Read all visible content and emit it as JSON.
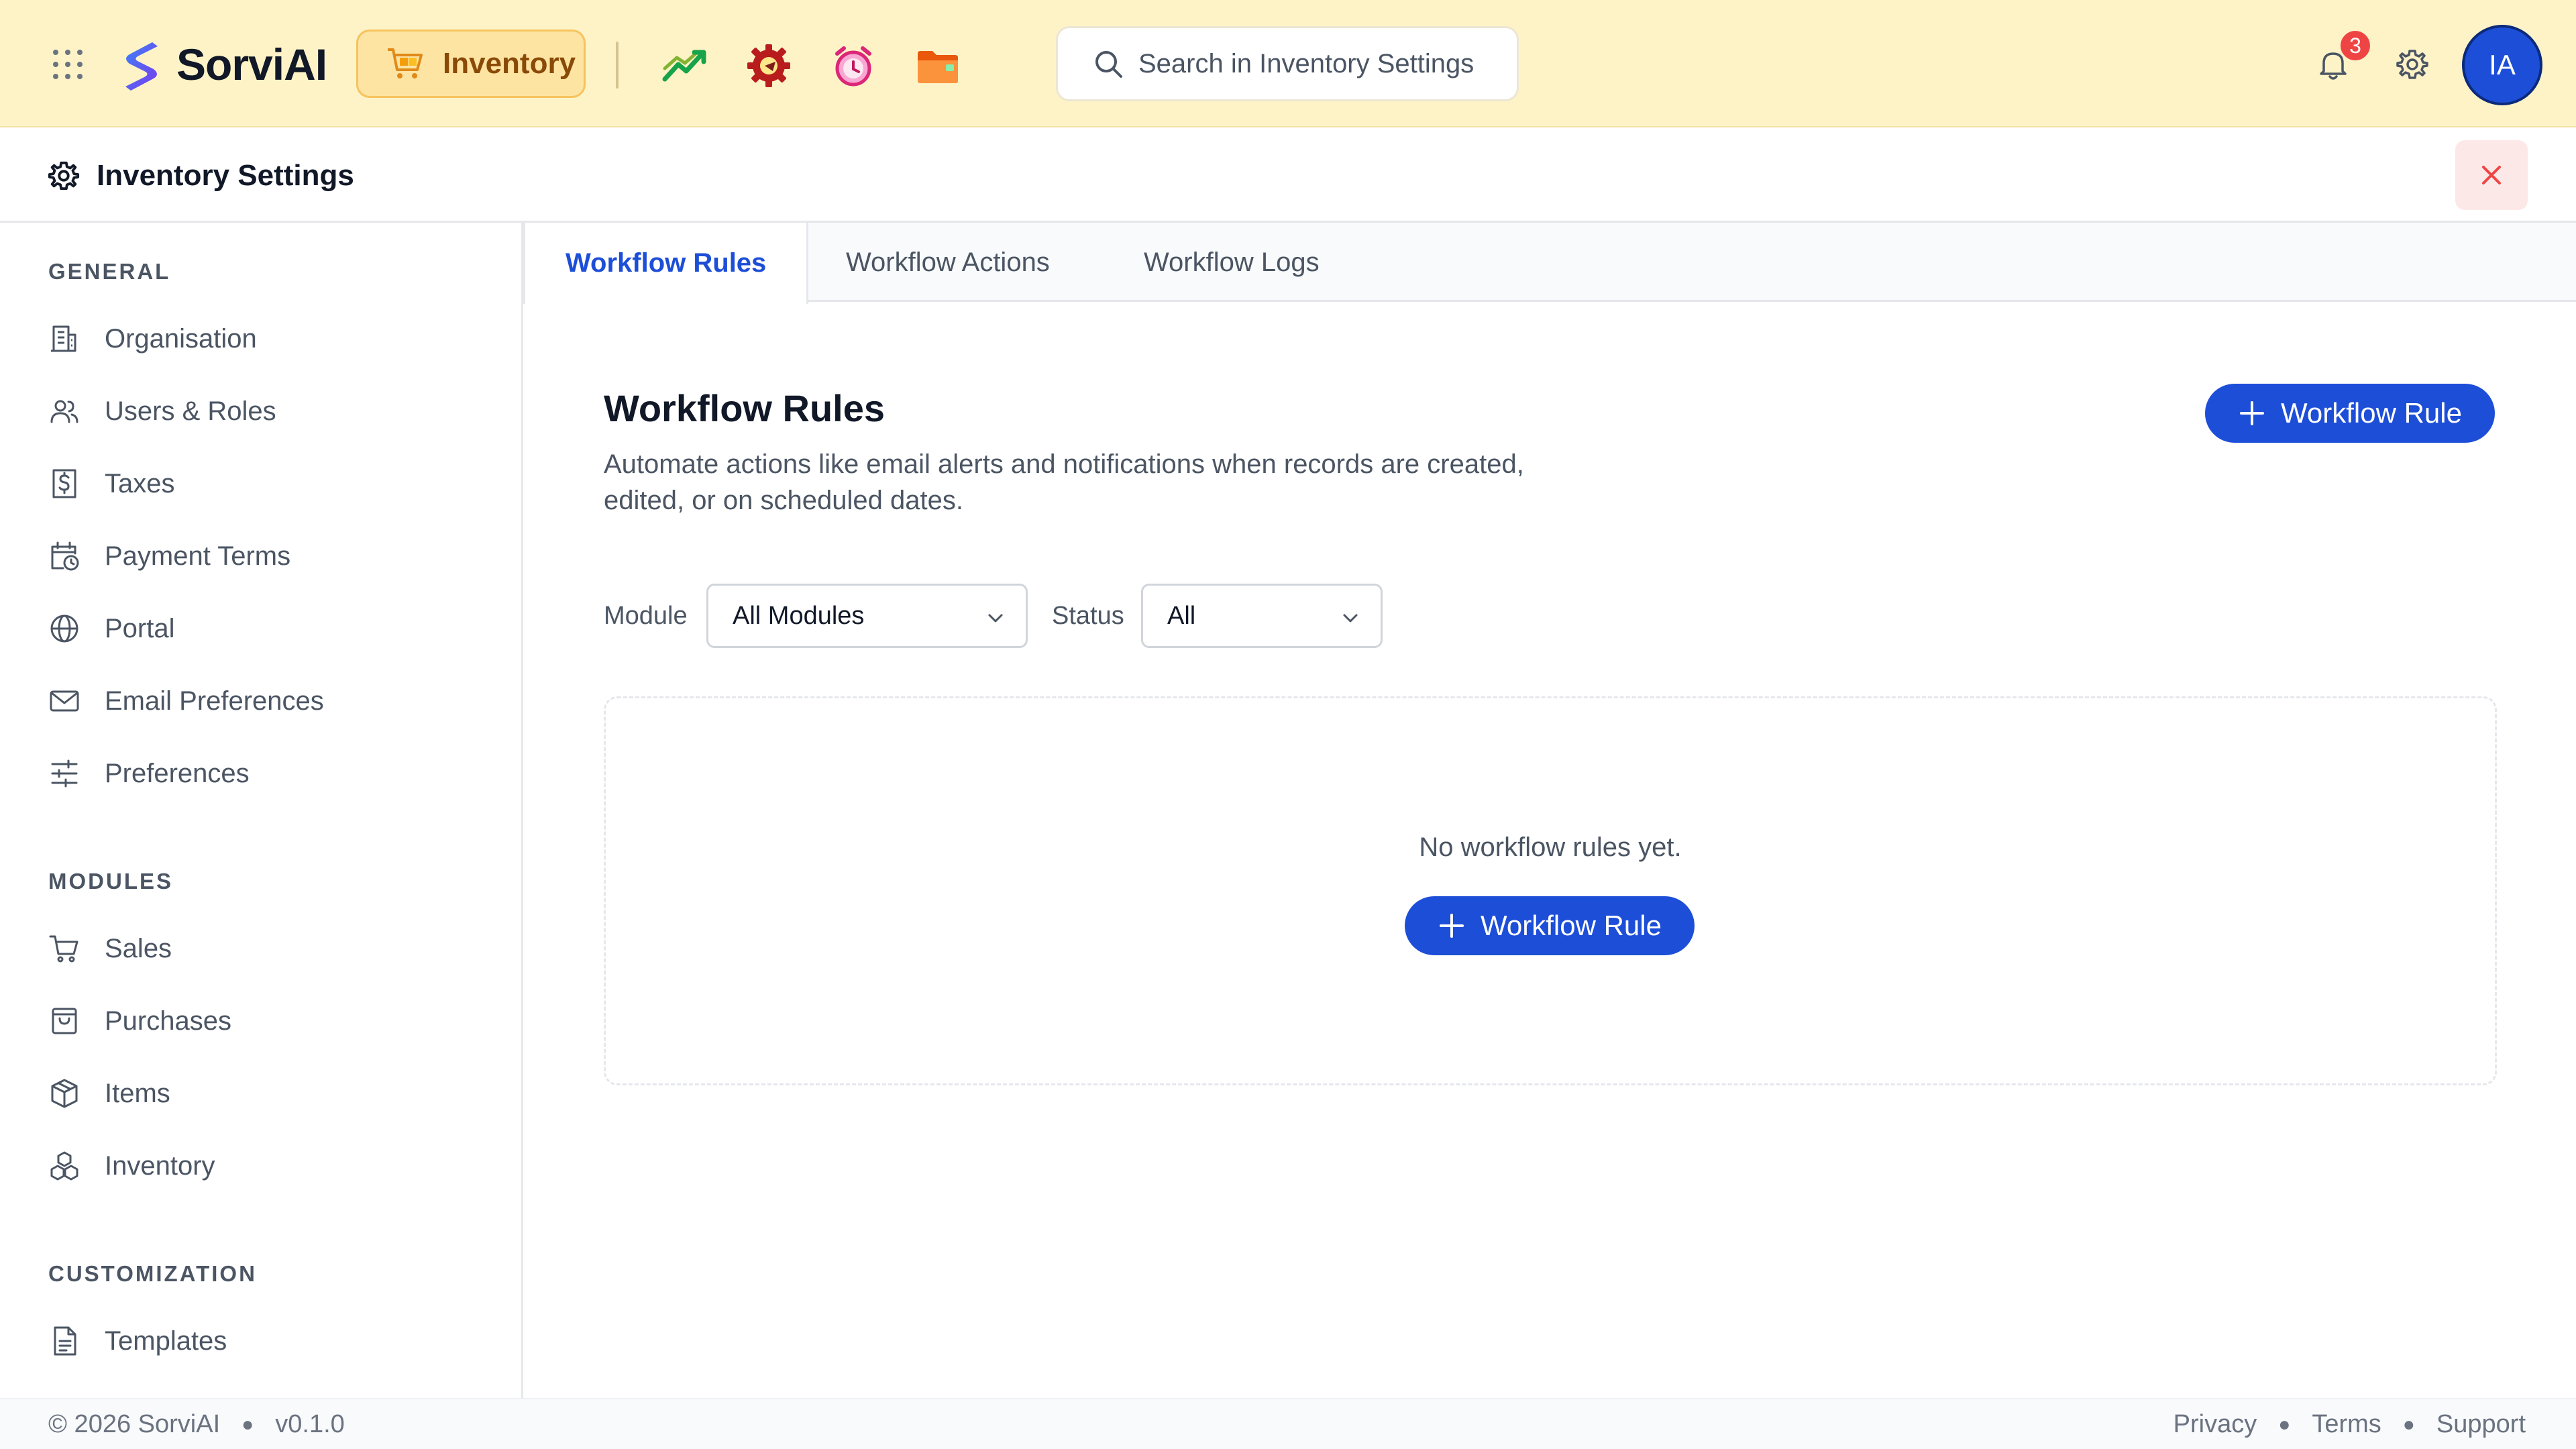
{
  "topbar": {
    "brand_name": "SorviAI",
    "current_app_label": "Inventory",
    "search_placeholder": "Search in Inventory Settings",
    "notification_count": "3",
    "user_initials": "IA",
    "app_icons": [
      "sales-trend-icon",
      "service-gear-icon",
      "alarm-clock-icon",
      "folder-app-icon"
    ],
    "colors": {
      "bar_bg": "#fef3c7",
      "chip_bg": "#fde4a3",
      "avatar_bg": "#1d4ed8",
      "badge_bg": "#ef4444"
    }
  },
  "settings_header": {
    "title": "Inventory Settings",
    "close_icon": "close-icon"
  },
  "sidebar": {
    "sections": [
      {
        "title": "GENERAL",
        "items": [
          {
            "label": "Organisation",
            "icon": "building-icon"
          },
          {
            "label": "Users & Roles",
            "icon": "users-icon"
          },
          {
            "label": "Taxes",
            "icon": "dollar-receipt-icon"
          },
          {
            "label": "Payment Terms",
            "icon": "calendar-clock-icon"
          },
          {
            "label": "Portal",
            "icon": "globe-icon"
          },
          {
            "label": "Email Preferences",
            "icon": "mail-icon"
          },
          {
            "label": "Preferences",
            "icon": "sliders-icon"
          }
        ]
      },
      {
        "title": "MODULES",
        "items": [
          {
            "label": "Sales",
            "icon": "cart-icon"
          },
          {
            "label": "Purchases",
            "icon": "shopping-bag-icon"
          },
          {
            "label": "Items",
            "icon": "box-icon"
          },
          {
            "label": "Inventory",
            "icon": "boxes-icon"
          }
        ]
      },
      {
        "title": "CUSTOMIZATION",
        "items": [
          {
            "label": "Templates",
            "icon": "document-icon"
          }
        ]
      }
    ]
  },
  "tabs": [
    {
      "label": "Workflow Rules",
      "active": true
    },
    {
      "label": "Workflow Actions",
      "active": false
    },
    {
      "label": "Workflow Logs",
      "active": false
    }
  ],
  "main": {
    "title": "Workflow Rules",
    "description": "Automate actions like email alerts and notifications when records are created, edited, or on scheduled dates.",
    "add_button_label": "Workflow Rule",
    "filters": {
      "module_label": "Module",
      "module_value": "All Modules",
      "status_label": "Status",
      "status_value": "All"
    },
    "empty_state": {
      "message": "No workflow rules yet.",
      "button_label": "Workflow Rule"
    },
    "accent_color": "#1d4ed8"
  },
  "footer": {
    "copyright": "© 2026 SorviAI",
    "version": "v0.1.0",
    "links": [
      "Privacy",
      "Terms",
      "Support"
    ]
  }
}
